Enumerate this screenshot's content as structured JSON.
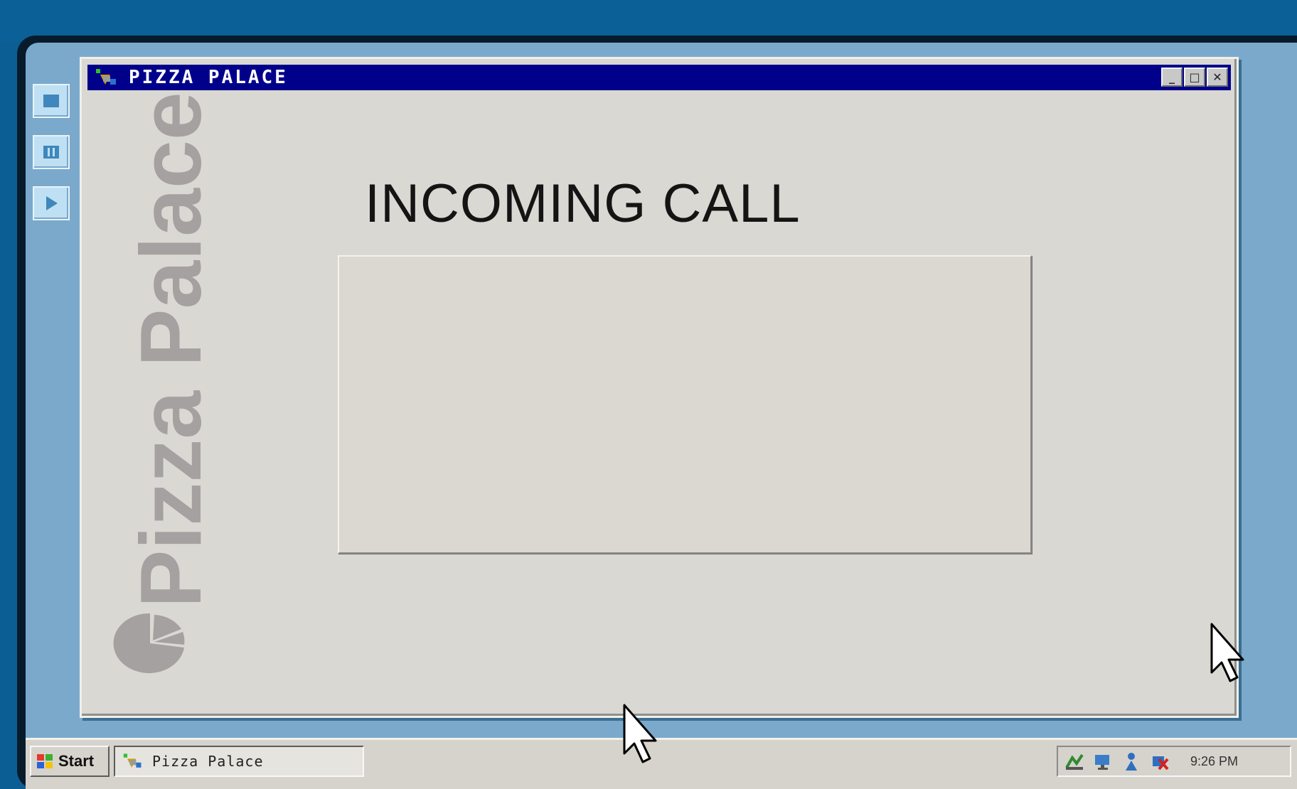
{
  "window": {
    "title": "PIZZA PALACE",
    "buttons": {
      "minimize": "_",
      "maximize": "□",
      "close": "✕"
    }
  },
  "brand": {
    "name": "Pizza Palace",
    "logo_icon": "pizza-slice-icon",
    "color": "#a4a1a0"
  },
  "main": {
    "heading": "INCOMING CALL"
  },
  "side_toolbar": {
    "buttons": [
      {
        "icon": "stop-icon"
      },
      {
        "icon": "pause-icon"
      },
      {
        "icon": "play-icon"
      }
    ]
  },
  "taskbar": {
    "start_label": "Start",
    "task_item_label": "Pizza Palace",
    "clock": "9:26 PM",
    "tray_icons": [
      "network-icon",
      "display-icon",
      "user-icon",
      "disconnected-icon"
    ]
  },
  "colors": {
    "titlebar": "#00008b",
    "desktop": "#7aa9cc",
    "window_bg": "#dad8d2"
  }
}
